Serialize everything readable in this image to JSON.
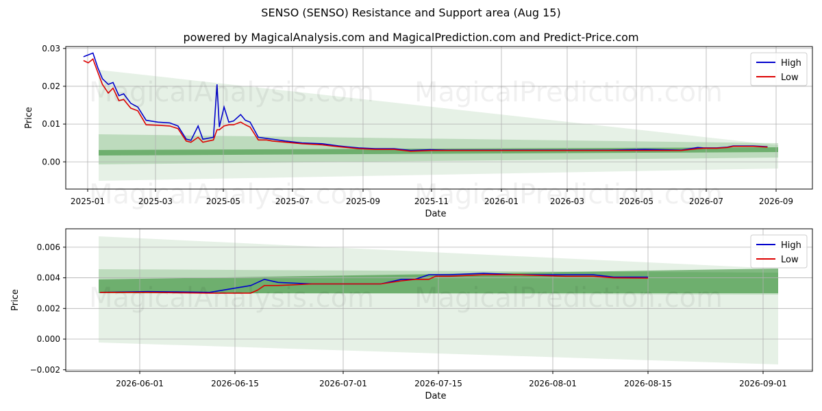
{
  "title": "SENSO (SENSO) Resistance and Support area (Aug 15)",
  "subtitle": "powered by MagicalAnalysis.com and MagicalPrediction.com and Predict-Price.com",
  "watermarks": [
    "MagicalAnalysis.com",
    "MagicalPrediction.com"
  ],
  "colors": {
    "high": "#0000cc",
    "low": "#dd0000",
    "band": "#2e8b2e"
  },
  "chart_data": [
    {
      "type": "line",
      "xlabel": "Date",
      "ylabel": "Price",
      "x_ticks": [
        "2025-01",
        "2025-03",
        "2025-05",
        "2025-07",
        "2025-09",
        "2025-11",
        "2026-01",
        "2026-03",
        "2026-05",
        "2026-07",
        "2026-09"
      ],
      "y_ticks": [
        "0.00",
        "0.01",
        "0.02",
        "0.03"
      ],
      "xlim": [
        "2024-12-27",
        "2026-09-20"
      ],
      "ylim": [
        -0.0072,
        0.0305
      ],
      "grid": true,
      "legend": "top-right",
      "series": [
        {
          "name": "High",
          "color": "#0000cc",
          "x": [
            "2025-01-11",
            "2025-01-15",
            "2025-01-19",
            "2025-01-23",
            "2025-01-27",
            "2025-02-01",
            "2025-02-05",
            "2025-02-10",
            "2025-02-14",
            "2025-02-20",
            "2025-02-26",
            "2025-03-05",
            "2025-03-15",
            "2025-03-25",
            "2025-04-01",
            "2025-04-08",
            "2025-04-12",
            "2025-04-18",
            "2025-04-22",
            "2025-05-01",
            "2025-05-04",
            "2025-05-06",
            "2025-05-10",
            "2025-05-14",
            "2025-05-18",
            "2025-05-24",
            "2025-05-28",
            "2025-06-01",
            "2025-06-08",
            "2025-06-15",
            "2025-06-20",
            "2025-07-01",
            "2025-07-15",
            "2025-08-01",
            "2025-08-15",
            "2025-09-01",
            "2025-09-15",
            "2025-10-01",
            "2025-10-15",
            "2025-11-01",
            "2025-11-15",
            "2025-12-01",
            "2026-01-01",
            "2026-02-01",
            "2026-03-01",
            "2026-04-01",
            "2026-05-01",
            "2026-06-01",
            "2026-06-15",
            "2026-06-20",
            "2026-07-01",
            "2026-07-10",
            "2026-07-15",
            "2026-08-01",
            "2026-08-13"
          ],
          "y": [
            0.0278,
            0.0283,
            0.0288,
            0.025,
            0.022,
            0.0205,
            0.021,
            0.0175,
            0.018,
            0.0155,
            0.0145,
            0.011,
            0.0105,
            0.0103,
            0.0095,
            0.006,
            0.0057,
            0.0095,
            0.006,
            0.0065,
            0.0205,
            0.0092,
            0.0145,
            0.0105,
            0.0108,
            0.0125,
            0.011,
            0.0105,
            0.0065,
            0.0062,
            0.006,
            0.0055,
            0.005,
            0.0048,
            0.0042,
            0.0037,
            0.0035,
            0.0035,
            0.003,
            0.0032,
            0.0031,
            0.0031,
            0.0031,
            0.0031,
            0.0031,
            0.0031,
            0.0033,
            0.0031,
            0.0038,
            0.0037,
            0.0037,
            0.0039,
            0.0042,
            0.0042,
            0.004
          ]
        },
        {
          "name": "Low",
          "color": "#dd0000",
          "x": [
            "2025-01-11",
            "2025-01-15",
            "2025-01-19",
            "2025-01-23",
            "2025-01-27",
            "2025-02-01",
            "2025-02-05",
            "2025-02-10",
            "2025-02-14",
            "2025-02-20",
            "2025-02-26",
            "2025-03-05",
            "2025-03-15",
            "2025-03-25",
            "2025-04-01",
            "2025-04-08",
            "2025-04-12",
            "2025-04-18",
            "2025-04-22",
            "2025-05-01",
            "2025-05-04",
            "2025-05-06",
            "2025-05-10",
            "2025-05-14",
            "2025-05-18",
            "2025-05-24",
            "2025-05-28",
            "2025-06-01",
            "2025-06-08",
            "2025-06-15",
            "2025-06-20",
            "2025-07-01",
            "2025-07-15",
            "2025-08-01",
            "2025-08-15",
            "2025-09-01",
            "2025-09-15",
            "2025-10-01",
            "2025-10-15",
            "2025-11-01",
            "2025-11-15",
            "2025-12-01",
            "2026-01-01",
            "2026-02-01",
            "2026-03-01",
            "2026-04-01",
            "2026-05-01",
            "2026-06-01",
            "2026-06-15",
            "2026-06-20",
            "2026-07-01",
            "2026-07-10",
            "2026-07-15",
            "2026-08-01",
            "2026-08-13"
          ],
          "y": [
            0.0268,
            0.0262,
            0.0272,
            0.0238,
            0.0205,
            0.0182,
            0.0195,
            0.0162,
            0.0165,
            0.0142,
            0.0135,
            0.0098,
            0.0097,
            0.0095,
            0.0088,
            0.0055,
            0.0052,
            0.0065,
            0.0052,
            0.0058,
            0.0085,
            0.0085,
            0.0095,
            0.0098,
            0.0098,
            0.0105,
            0.0098,
            0.0092,
            0.0058,
            0.0058,
            0.0055,
            0.0052,
            0.0048,
            0.0045,
            0.004,
            0.0035,
            0.0033,
            0.0033,
            0.0028,
            0.003,
            0.003,
            0.003,
            0.003,
            0.003,
            0.003,
            0.003,
            0.003,
            0.003,
            0.0035,
            0.0036,
            0.0036,
            0.0038,
            0.0041,
            0.0041,
            0.0039
          ]
        }
      ]
    },
    {
      "type": "line",
      "xlabel": "Date",
      "ylabel": "Price",
      "x_ticks": [
        "2026-06-01",
        "2026-06-15",
        "2026-07-01",
        "2026-07-15",
        "2026-08-01",
        "2026-08-15",
        "2026-09-01"
      ],
      "y_ticks": [
        "−0.002",
        "0.000",
        "0.002",
        "0.004",
        "0.006"
      ],
      "xlim": [
        "2026-05-20",
        "2026-09-06"
      ],
      "ylim": [
        -0.0021,
        0.0072
      ],
      "grid": true,
      "legend": "top-right",
      "series": [
        {
          "name": "High",
          "color": "#0000cc",
          "x": [
            "2026-05-25",
            "2026-06-01",
            "2026-06-05",
            "2026-06-10",
            "2026-06-16",
            "2026-06-17",
            "2026-06-18",
            "2026-06-20",
            "2026-06-25",
            "2026-07-01",
            "2026-07-05",
            "2026-07-08",
            "2026-07-10",
            "2026-07-12",
            "2026-07-13",
            "2026-07-15",
            "2026-07-20",
            "2026-07-25",
            "2026-08-01",
            "2026-08-05",
            "2026-08-08",
            "2026-08-13"
          ],
          "y": [
            0.00305,
            0.0031,
            0.00308,
            0.00305,
            0.0035,
            0.0037,
            0.0039,
            0.0037,
            0.0036,
            0.0036,
            0.0036,
            0.0039,
            0.0039,
            0.0042,
            0.0042,
            0.0042,
            0.0043,
            0.0042,
            0.0042,
            0.0042,
            0.00405,
            0.00405
          ]
        },
        {
          "name": "Low",
          "color": "#dd0000",
          "x": [
            "2026-05-25",
            "2026-06-01",
            "2026-06-05",
            "2026-06-10",
            "2026-06-16",
            "2026-06-17",
            "2026-06-18",
            "2026-06-20",
            "2026-06-25",
            "2026-07-01",
            "2026-07-05",
            "2026-07-08",
            "2026-07-10",
            "2026-07-12",
            "2026-07-13",
            "2026-07-15",
            "2026-07-20",
            "2026-07-25",
            "2026-08-01",
            "2026-08-05",
            "2026-08-08",
            "2026-08-13"
          ],
          "y": [
            0.00305,
            0.00305,
            0.00303,
            0.003,
            0.003,
            0.0032,
            0.0035,
            0.0035,
            0.0036,
            0.0036,
            0.0036,
            0.0038,
            0.0039,
            0.0039,
            0.0041,
            0.0041,
            0.0042,
            0.0042,
            0.0041,
            0.0041,
            0.004,
            0.00398
          ]
        }
      ]
    }
  ]
}
